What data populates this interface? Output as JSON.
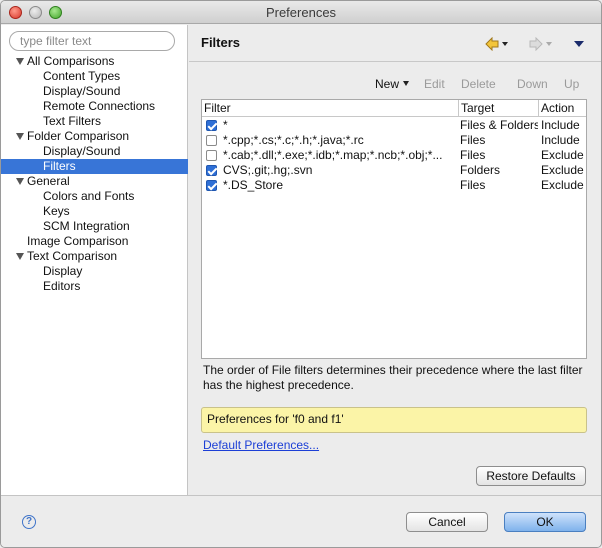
{
  "window": {
    "title": "Preferences"
  },
  "sidebar": {
    "filter_placeholder": "type filter text",
    "items": [
      {
        "label": "All Comparisons",
        "level": 0,
        "expanded": true
      },
      {
        "label": "Content Types",
        "level": 1
      },
      {
        "label": "Display/Sound",
        "level": 1
      },
      {
        "label": "Remote Connections",
        "level": 1
      },
      {
        "label": "Text Filters",
        "level": 1
      },
      {
        "label": "Folder Comparison",
        "level": 0,
        "expanded": true
      },
      {
        "label": "Display/Sound",
        "level": 1
      },
      {
        "label": "Filters",
        "level": 1,
        "selected": true
      },
      {
        "label": "General",
        "level": 0,
        "expanded": true
      },
      {
        "label": "Colors and Fonts",
        "level": 1
      },
      {
        "label": "Keys",
        "level": 1
      },
      {
        "label": "SCM Integration",
        "level": 1
      },
      {
        "label": "Image Comparison",
        "level": 0
      },
      {
        "label": "Text Comparison",
        "level": 0,
        "expanded": true
      },
      {
        "label": "Display",
        "level": 1
      },
      {
        "label": "Editors",
        "level": 1
      }
    ]
  },
  "page": {
    "title": "Filters",
    "icons": {
      "back": "back-arrow-icon",
      "forward": "forward-arrow-icon",
      "menu": "view-menu-icon"
    }
  },
  "toolbar": {
    "new_label": "New",
    "edit_label": "Edit",
    "delete_label": "Delete",
    "down_label": "Down",
    "up_label": "Up"
  },
  "table": {
    "columns": [
      "Filter",
      "Target",
      "Action"
    ],
    "rows": [
      {
        "checked": true,
        "filter": "*",
        "target": "Files & Folders",
        "action": "Include"
      },
      {
        "checked": false,
        "filter": "*.cpp;*.cs;*.c;*.h;*.java;*.rc",
        "target": "Files",
        "action": "Include"
      },
      {
        "checked": false,
        "filter": "*.cab;*.dll;*.exe;*.idb;*.map;*.ncb;*.obj;*...",
        "target": "Files",
        "action": "Exclude"
      },
      {
        "checked": true,
        "filter": "CVS;.git;.hg;.svn",
        "target": "Folders",
        "action": "Exclude"
      },
      {
        "checked": true,
        "filter": "*.DS_Store",
        "target": "Files",
        "action": "Exclude"
      }
    ]
  },
  "description": "The order of File filters determines their precedence where the last filter has the highest precedence.",
  "context_box": "Preferences for 'f0 and f1'",
  "default_prefs_link": "Default Preferences...",
  "restore_defaults_label": "Restore Defaults",
  "cancel_label": "Cancel",
  "ok_label": "OK",
  "colors": {
    "selection": "#3875d7",
    "context_highlight": "#fbf4a7",
    "link": "#1c3fd6",
    "checkbox_checked": "#2e6fd6"
  }
}
